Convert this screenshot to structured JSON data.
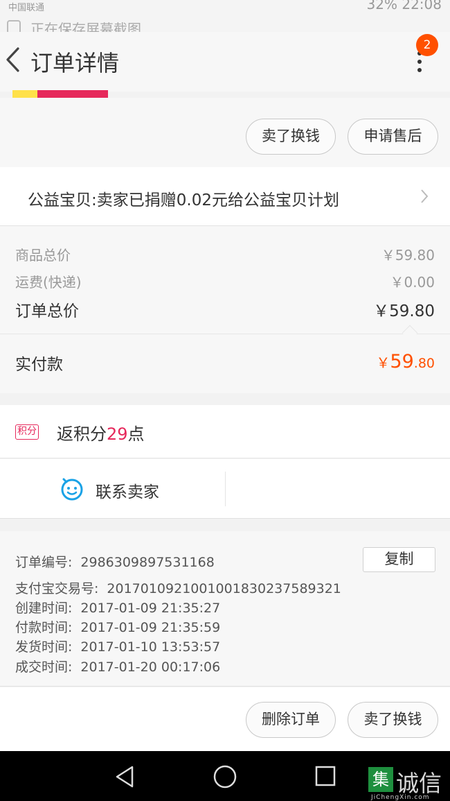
{
  "status_bar": {
    "carrier": "中国联通",
    "right": "32%   22:08"
  },
  "notification": {
    "text": "正在保存屏幕截图"
  },
  "header": {
    "title": "订单详情",
    "badge_count": "2"
  },
  "top_actions": {
    "sell_label": "卖了换钱",
    "aftersale_label": "申请售后"
  },
  "charity": {
    "text": "公益宝贝:卖家已捐赠0.02元给公益宝贝计划"
  },
  "price": {
    "goods_label": "商品总价",
    "goods_value": "￥59.80",
    "shipping_label": "运费(快递)",
    "shipping_value": "￥0.00",
    "total_label": "订单总价",
    "total_value": "￥59.80",
    "paid_label": "实付款",
    "paid_currency": "￥",
    "paid_int": "59",
    "paid_dec": ".80"
  },
  "points": {
    "tag": "积分",
    "prefix": "返积分",
    "count": "29",
    "suffix": "点"
  },
  "contact": {
    "label": "联系卖家"
  },
  "order_info": {
    "order_no_label": "订单编号:",
    "order_no": "2986309897531168",
    "copy_label": "复制",
    "alipay_label": "支付宝交易号:",
    "alipay_no": "2017010921001001830237589321",
    "created_label": "创建时间:",
    "created": "2017-01-09 21:35:27",
    "paid_label": "付款时间:",
    "paid": "2017-01-09 21:35:59",
    "shipped_label": "发货时间:",
    "shipped": "2017-01-10 13:53:57",
    "done_label": "成交时间:",
    "done": "2017-01-20 00:17:06"
  },
  "bottom_actions": {
    "delete_label": "删除订单",
    "sell_label": "卖了换钱"
  },
  "watermark": {
    "char": "集",
    "text": "诚信",
    "sub": "JiChengXin.com"
  },
  "colors": {
    "accent": "#ff5000",
    "points": "#e6285b",
    "contact_icon": "#1aa2e6"
  }
}
